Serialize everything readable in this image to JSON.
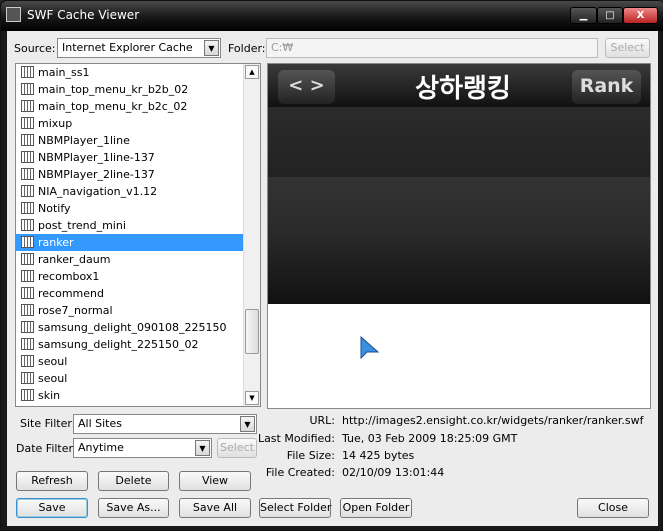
{
  "window": {
    "title": "SWF Cache Viewer",
    "minimize": "▁",
    "maximize": "□",
    "close": "X"
  },
  "source": {
    "label": "Source:",
    "value": "Internet Explorer Cache"
  },
  "folder": {
    "label": "Folder:",
    "value": "C:₩",
    "select_label": "Select"
  },
  "files": [
    {
      "name": "main_ss1"
    },
    {
      "name": "main_top_menu_kr_b2b_02"
    },
    {
      "name": "main_top_menu_kr_b2c_02"
    },
    {
      "name": "mixup"
    },
    {
      "name": "NBMPlayer_1line"
    },
    {
      "name": "NBMPlayer_1line-137"
    },
    {
      "name": "NBMPlayer_2line-137"
    },
    {
      "name": "NIA_navigation_v1.12"
    },
    {
      "name": "Notify"
    },
    {
      "name": "post_trend_mini"
    },
    {
      "name": "ranker",
      "selected": true
    },
    {
      "name": "ranker_daum"
    },
    {
      "name": "recombox1"
    },
    {
      "name": "recommend"
    },
    {
      "name": "rose7_normal"
    },
    {
      "name": "samsung_delight_090108_225150"
    },
    {
      "name": "samsung_delight_225150_02"
    },
    {
      "name": "seoul"
    },
    {
      "name": "seoul"
    },
    {
      "name": "skin"
    }
  ],
  "preview": {
    "nav_arrows": "< >",
    "title": "상하랭킹",
    "rank_button": "Rank",
    "cursor": "arrow-cursor-icon"
  },
  "site_filter": {
    "label": "Site Filter:",
    "value": "All Sites"
  },
  "date_filter": {
    "label": "Date Filter:",
    "value": "Anytime",
    "select_label": "Select"
  },
  "info": {
    "url_label": "URL:",
    "url": "http://images2.ensight.co.kr/widgets/ranker/ranker.swf",
    "modified_label": "Last Modified:",
    "modified": "Tue, 03 Feb 2009 18:25:09 GMT",
    "size_label": "File Size:",
    "size": "14 425 bytes",
    "created_label": "File Created:",
    "created": "02/10/09 13:01:44"
  },
  "buttons": {
    "refresh": "Refresh",
    "delete": "Delete",
    "view": "View",
    "save": "Save",
    "save_as": "Save As...",
    "save_all": "Save All",
    "select_folder": "Select Folder",
    "open_folder": "Open Folder",
    "close": "Close"
  }
}
